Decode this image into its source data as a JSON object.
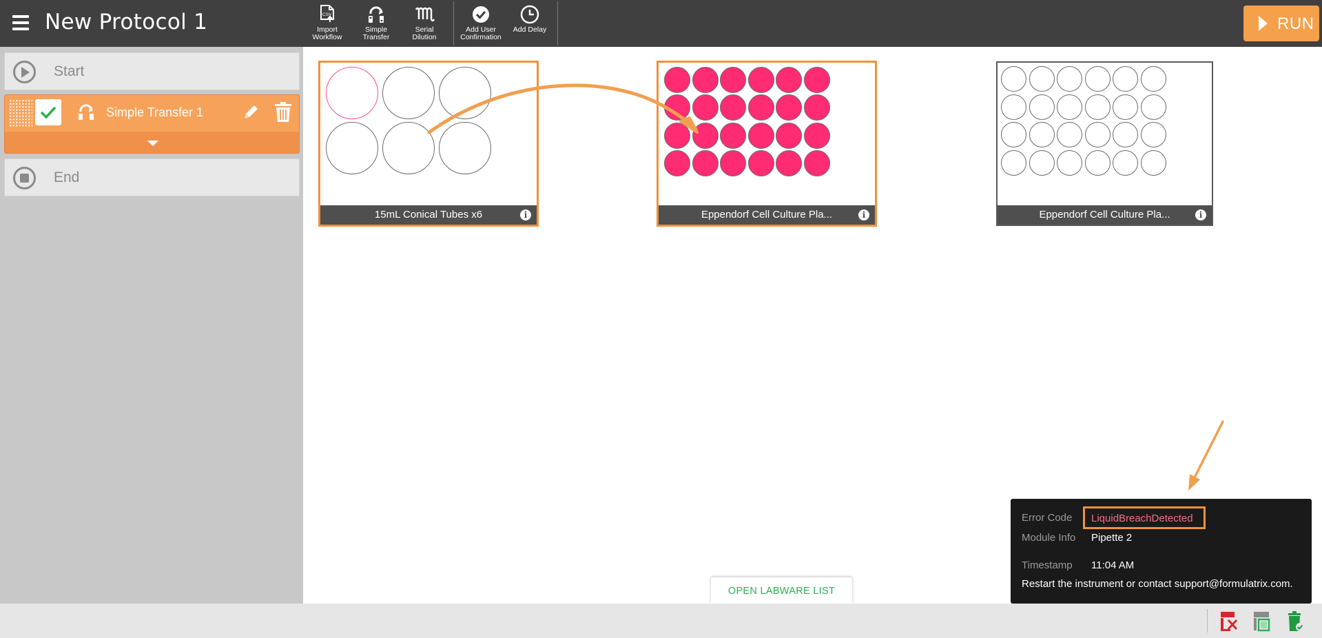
{
  "app": {
    "title": "New Protocol 1"
  },
  "toolbar": {
    "tools": [
      {
        "label_line1": "Import",
        "label_line2": "Workflow",
        "icon": "import-csv-icon"
      },
      {
        "label_line1": "Simple",
        "label_line2": "Transfer",
        "icon": "simple-transfer-icon"
      },
      {
        "label_line1": "Serial",
        "label_line2": "Dilution",
        "icon": "serial-dilution-icon"
      },
      {
        "label_line1": "Add User",
        "label_line2": "Confirmation",
        "icon": "check-circle-icon"
      },
      {
        "label_line1": "Add Delay",
        "label_line2": "",
        "icon": "clock-icon"
      }
    ],
    "run_label": "RUN"
  },
  "sidebar": {
    "start_label": "Start",
    "end_label": "End",
    "steps": [
      {
        "label": "Simple Transfer 1",
        "checked": true
      }
    ]
  },
  "labware": [
    {
      "name": "15mL Conical Tubes x6",
      "selected": true,
      "rows": 2,
      "cols": 3,
      "filled": false,
      "source_wells": [
        0
      ]
    },
    {
      "name": "Eppendorf Cell Culture Pla...",
      "selected": true,
      "rows": 4,
      "cols": 6,
      "filled": true
    },
    {
      "name": "Eppendorf Cell Culture Pla...",
      "selected": false,
      "rows": 4,
      "cols": 6,
      "filled": false
    }
  ],
  "open_labware_list_label": "OPEN LABWARE LIST",
  "error_tooltip": {
    "error_code_label": "Error Code",
    "error_code": "LiquidBreachDetected",
    "module_info_label": "Module Info",
    "module_info": "Pipette 2",
    "timestamp_label": "Timestamp",
    "timestamp": "11:04 AM",
    "message": "Restart the instrument or contact support@formulatrix.com."
  },
  "colors": {
    "accent": "#f0913c",
    "well_fill": "#ff2b73",
    "error_text": "#ff6a85",
    "run_button": "#f5a04a"
  },
  "status_icons": [
    "instrument-error-icon",
    "instrument-screen-icon",
    "trash-ok-icon"
  ]
}
